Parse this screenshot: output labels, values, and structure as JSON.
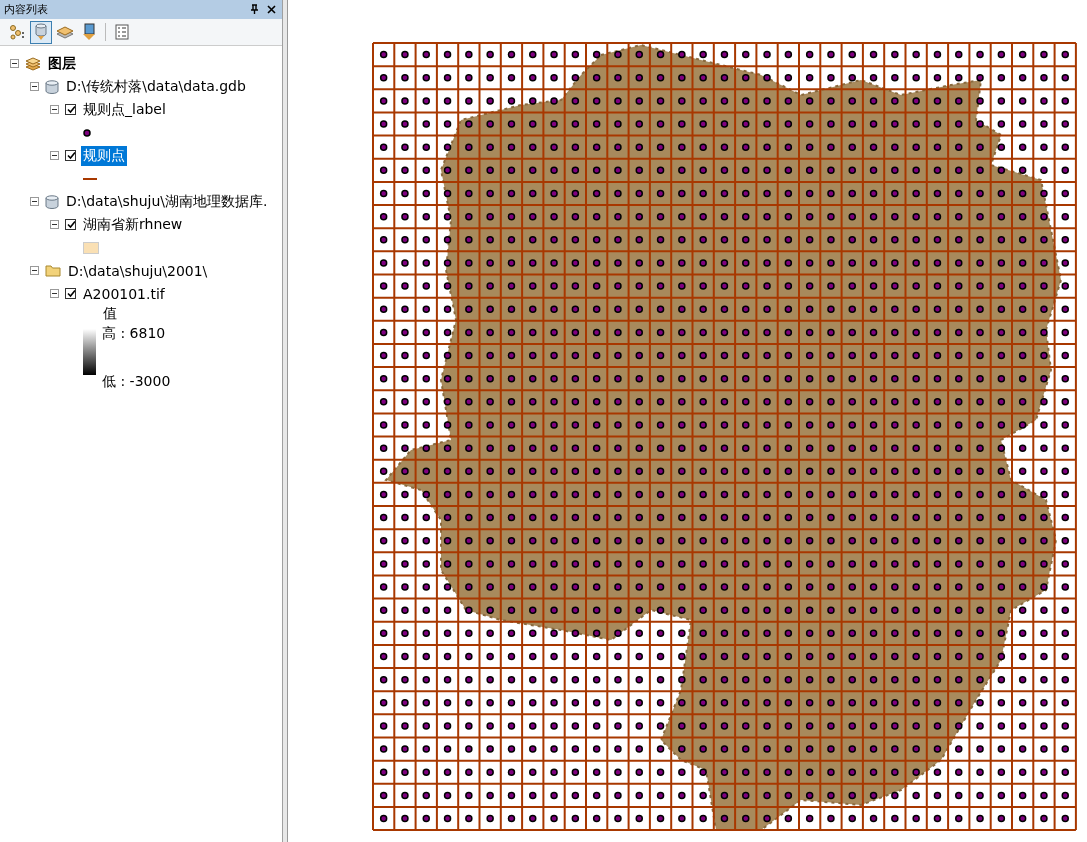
{
  "panel": {
    "title": "内容列表"
  },
  "toolbar": [
    {
      "selected": false
    },
    {
      "selected": true
    },
    {
      "selected": false
    },
    {
      "selected": false
    },
    {
      "selected": false
    }
  ],
  "tree": [
    {
      "kind": "group",
      "label": "图层",
      "expanded": true,
      "children": [
        {
          "kind": "database",
          "label": "D:\\传统村落\\data\\data.gdb",
          "expanded": true,
          "children": [
            {
              "kind": "layer",
              "label": "规则点_label",
              "expanded": true,
              "checked": true,
              "selected": false,
              "legend": {
                "kind": "point",
                "color": "#800080"
              }
            },
            {
              "kind": "layer",
              "label": "规则点",
              "expanded": true,
              "checked": true,
              "selected": true,
              "legend": {
                "kind": "line",
                "color": "#a83800"
              }
            }
          ]
        },
        {
          "kind": "database",
          "label": "D:\\data\\shuju\\湖南地理数据库.",
          "expanded": true,
          "children": [
            {
              "kind": "layer",
              "label": "湖南省新rhnew",
              "expanded": true,
              "checked": true,
              "selected": false,
              "legend": {
                "kind": "fill",
                "color": "#fae0b4"
              }
            }
          ]
        },
        {
          "kind": "folder",
          "label": "D:\\data\\shuju\\2001\\",
          "expanded": true,
          "children": [
            {
              "kind": "layer",
              "label": "A200101.tif",
              "expanded": true,
              "checked": true,
              "selected": false,
              "legend": {
                "kind": "gradient",
                "heading": "值",
                "high": "高 : 6810",
                "low": "低 : -3000"
              }
            }
          ]
        }
      ]
    }
  ]
}
